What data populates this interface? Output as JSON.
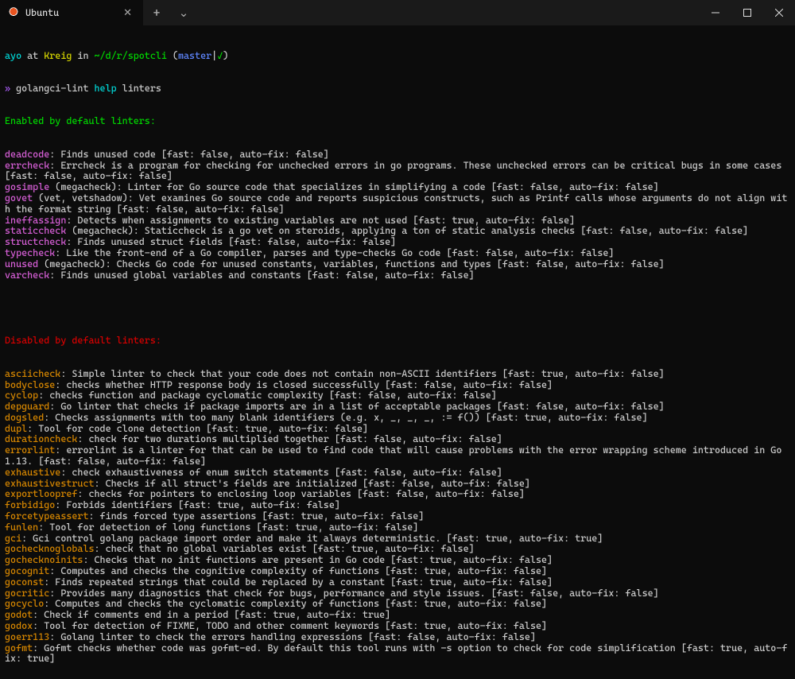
{
  "titlebar": {
    "tab_title": "Ubuntu",
    "tab_close": "✕",
    "new_tab": "+",
    "dropdown": "⌄"
  },
  "prompt": {
    "user": "ayo",
    "at": " at ",
    "host": "Kreig",
    "in": " in ",
    "path": "~/d/r/spotcli",
    "branch_open": " (",
    "branch": "master",
    "branch_sep": "|",
    "branch_check": "✓",
    "branch_close": ")",
    "symbol": "» ",
    "cmd1": "golangci-lint",
    "cmd2": " help",
    "cmd3": " linters"
  },
  "section1": "Enabled by default linters:",
  "enabled": [
    {
      "name": "deadcode",
      "desc": ": Finds unused code [fast: false, auto-fix: false]"
    },
    {
      "name": "errcheck",
      "desc": ": Errcheck is a program for checking for unchecked errors in go programs. These unchecked errors can be critical bugs in some cases [fast: false, auto-fix: false]"
    },
    {
      "name": "gosimple",
      "desc": " (megacheck): Linter for Go source code that specializes in simplifying a code [fast: false, auto-fix: false]"
    },
    {
      "name": "govet",
      "desc": " (vet, vetshadow): Vet examines Go source code and reports suspicious constructs, such as Printf calls whose arguments do not align with the format string [fast: false, auto-fix: false]"
    },
    {
      "name": "ineffassign",
      "desc": ": Detects when assignments to existing variables are not used [fast: true, auto-fix: false]"
    },
    {
      "name": "staticcheck",
      "desc": " (megacheck): Staticcheck is a go vet on steroids, applying a ton of static analysis checks [fast: false, auto-fix: false]"
    },
    {
      "name": "structcheck",
      "desc": ": Finds unused struct fields [fast: false, auto-fix: false]"
    },
    {
      "name": "typecheck",
      "desc": ": Like the front-end of a Go compiler, parses and type-checks Go code [fast: false, auto-fix: false]"
    },
    {
      "name": "unused",
      "desc": " (megacheck): Checks Go code for unused constants, variables, functions and types [fast: false, auto-fix: false]"
    },
    {
      "name": "varcheck",
      "desc": ": Finds unused global variables and constants [fast: false, auto-fix: false]"
    }
  ],
  "section2": "Disabled by default linters:",
  "disabled": [
    {
      "name": "asciicheck",
      "desc": ": Simple linter to check that your code does not contain non-ASCII identifiers [fast: true, auto-fix: false]"
    },
    {
      "name": "bodyclose",
      "desc": ": checks whether HTTP response body is closed successfully [fast: false, auto-fix: false]"
    },
    {
      "name": "cyclop",
      "desc": ": checks function and package cyclomatic complexity [fast: false, auto-fix: false]"
    },
    {
      "name": "depguard",
      "desc": ": Go linter that checks if package imports are in a list of acceptable packages [fast: false, auto-fix: false]"
    },
    {
      "name": "dogsled",
      "desc": ": Checks assignments with too many blank identifiers (e.g. x, _, _, _, := f()) [fast: true, auto-fix: false]"
    },
    {
      "name": "dupl",
      "desc": ": Tool for code clone detection [fast: true, auto-fix: false]"
    },
    {
      "name": "durationcheck",
      "desc": ": check for two durations multiplied together [fast: false, auto-fix: false]"
    },
    {
      "name": "errorlint",
      "desc": ": errorlint is a linter for that can be used to find code that will cause problems with the error wrapping scheme introduced in Go 1.13. [fast: false, auto-fix: false]"
    },
    {
      "name": "exhaustive",
      "desc": ": check exhaustiveness of enum switch statements [fast: false, auto-fix: false]"
    },
    {
      "name": "exhaustivestruct",
      "desc": ": Checks if all struct's fields are initialized [fast: false, auto-fix: false]"
    },
    {
      "name": "exportloopref",
      "desc": ": checks for pointers to enclosing loop variables [fast: false, auto-fix: false]"
    },
    {
      "name": "forbidigo",
      "desc": ": Forbids identifiers [fast: true, auto-fix: false]"
    },
    {
      "name": "forcetypeassert",
      "desc": ": finds forced type assertions [fast: true, auto-fix: false]"
    },
    {
      "name": "funlen",
      "desc": ": Tool for detection of long functions [fast: true, auto-fix: false]"
    },
    {
      "name": "gci",
      "desc": ": Gci control golang package import order and make it always deterministic. [fast: true, auto-fix: true]"
    },
    {
      "name": "gochecknoglobals",
      "desc": ": check that no global variables exist [fast: true, auto-fix: false]"
    },
    {
      "name": "gochecknoinits",
      "desc": ": Checks that no init functions are present in Go code [fast: true, auto-fix: false]"
    },
    {
      "name": "gocognit",
      "desc": ": Computes and checks the cognitive complexity of functions [fast: true, auto-fix: false]"
    },
    {
      "name": "goconst",
      "desc": ": Finds repeated strings that could be replaced by a constant [fast: true, auto-fix: false]"
    },
    {
      "name": "gocritic",
      "desc": ": Provides many diagnostics that check for bugs, performance and style issues. [fast: false, auto-fix: false]"
    },
    {
      "name": "gocyclo",
      "desc": ": Computes and checks the cyclomatic complexity of functions [fast: true, auto-fix: false]"
    },
    {
      "name": "godot",
      "desc": ": Check if comments end in a period [fast: true, auto-fix: true]"
    },
    {
      "name": "godox",
      "desc": ": Tool for detection of FIXME, TODO and other comment keywords [fast: true, auto-fix: false]"
    },
    {
      "name": "goerr113",
      "desc": ": Golang linter to check the errors handling expressions [fast: false, auto-fix: false]"
    },
    {
      "name": "gofmt",
      "desc": ": Gofmt checks whether code was gofmt-ed. By default this tool runs with -s option to check for code simplification [fast: true, auto-fix: true]"
    }
  ]
}
